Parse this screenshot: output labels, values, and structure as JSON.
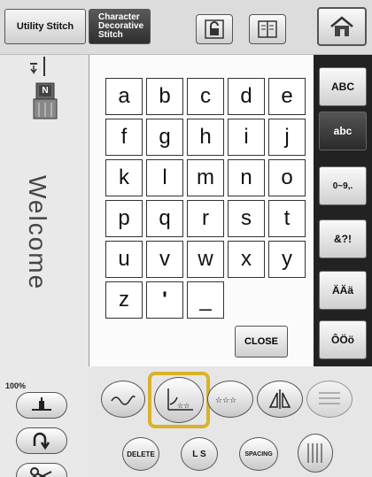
{
  "topbar": {
    "tab_utility": "Utility Stitch",
    "tab_character": "Character\nDecorative\nStitch"
  },
  "left": {
    "presser_label": "N",
    "welcome_text": "Welcome",
    "zoom_label": "100%"
  },
  "keyboard": {
    "rows": [
      [
        "a",
        "b",
        "c",
        "d",
        "e"
      ],
      [
        "f",
        "g",
        "h",
        "i",
        "j"
      ],
      [
        "k",
        "l",
        "m",
        "n",
        "o"
      ],
      [
        "p",
        "q",
        "r",
        "s",
        "t"
      ],
      [
        "u",
        "v",
        "w",
        "x",
        "y"
      ],
      [
        "z",
        "'",
        "_"
      ]
    ],
    "close_label": "CLOSE"
  },
  "modes": [
    {
      "label": "ABC",
      "active": false
    },
    {
      "label": "abc",
      "active": true
    },
    {
      "label": "0~9,.",
      "active": false
    },
    {
      "label": "&?!",
      "active": false
    },
    {
      "label": "ÄÄä",
      "active": false
    },
    {
      "label": "ÔÖö",
      "active": false
    }
  ],
  "bottom": {
    "delete_label": "DELETE",
    "ls_label": "L S",
    "spacing_label": "SPACING"
  },
  "colors": {
    "highlight": "#d9b22a",
    "active_mode": "#2a2a2a"
  }
}
